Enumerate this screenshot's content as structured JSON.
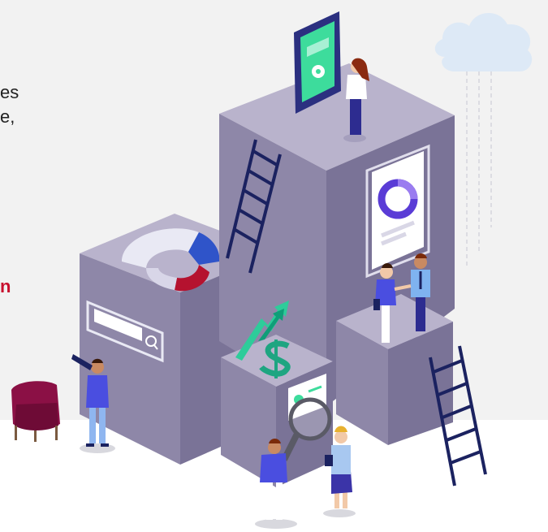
{
  "hero": {
    "cropped_lines": [
      "es",
      "e,"
    ],
    "cropped_link_fragment": "n",
    "colors": {
      "background": "#f2f2f2",
      "text": "#222222",
      "accent": "#c8102e",
      "block_top": "#b9b3cc",
      "block_left": "#8e87a8",
      "block_right": "#7a7397",
      "ladder": "#1b2260",
      "figure_shirt": "#4a4ee0",
      "chart_teal": "#2ecc9a",
      "chair": "#8b1045"
    },
    "icons": [
      "cloud-icon",
      "tablet-settings-icon",
      "donut-chart-card-icon",
      "search-bar-icon",
      "growth-arrow-icon",
      "dollar-icon",
      "magnifier-icon",
      "ladder-icon",
      "armchair-icon"
    ]
  }
}
